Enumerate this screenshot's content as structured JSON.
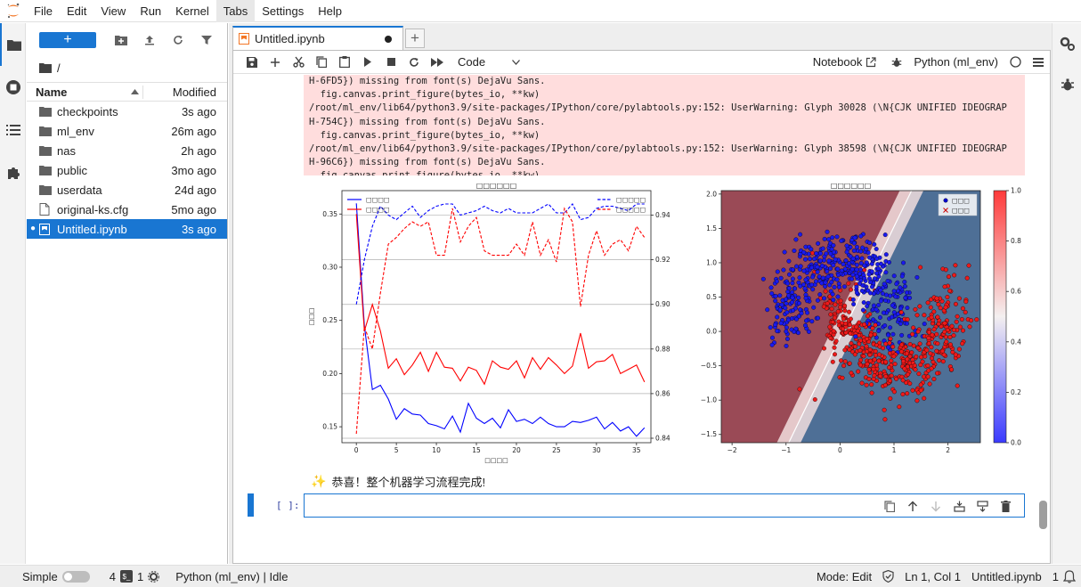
{
  "menubar": {
    "items": [
      "File",
      "Edit",
      "View",
      "Run",
      "Kernel",
      "Tabs",
      "Settings",
      "Help"
    ],
    "active_index": 5
  },
  "filebrowser": {
    "new_label": "+",
    "breadcrumb": "/",
    "header": {
      "name": "Name",
      "modified": "Modified"
    },
    "items": [
      {
        "name": "checkpoints",
        "modified": "3s ago",
        "type": "folder"
      },
      {
        "name": "ml_env",
        "modified": "26m ago",
        "type": "folder"
      },
      {
        "name": "nas",
        "modified": "2h ago",
        "type": "folder"
      },
      {
        "name": "public",
        "modified": "3mo ago",
        "type": "folder"
      },
      {
        "name": "userdata",
        "modified": "24d ago",
        "type": "folder"
      },
      {
        "name": "original-ks.cfg",
        "modified": "5mo ago",
        "type": "file"
      },
      {
        "name": "Untitled.ipynb",
        "modified": "3s ago",
        "type": "notebook",
        "selected": true,
        "running": true
      }
    ]
  },
  "tabs": {
    "active": {
      "label": "Untitled.ipynb",
      "dirty": true
    }
  },
  "notebook_toolbar": {
    "cell_type": "Code",
    "notebook_label": "Notebook",
    "kernel": "Python (ml_env)"
  },
  "stderr_lines": [
    "H-6FD5}) missing from font(s) DejaVu Sans.",
    "  fig.canvas.print_figure(bytes_io, **kw)",
    "/root/ml_env/lib64/python3.9/site-packages/IPython/core/pylabtools.py:152: UserWarning: Glyph 30028 (\\N{CJK UNIFIED IDEOGRAP",
    "H-754C}) missing from font(s) DejaVu Sans.",
    "  fig.canvas.print_figure(bytes_io, **kw)",
    "/root/ml_env/lib64/python3.9/site-packages/IPython/core/pylabtools.py:152: UserWarning: Glyph 38598 (\\N{CJK UNIFIED IDEOGRAP",
    "H-96C6}) missing from font(s) DejaVu Sans.",
    "  fig.canvas.print_figure(bytes_io, **kw)"
  ],
  "success_icon": "sparkles-icon",
  "success_message": "恭喜！整个机器学习流程完成!",
  "empty_cell_prompt": "[ ]:",
  "chart_data": [
    {
      "type": "line",
      "title": "□□□□□□",
      "xlabel": "□□□□",
      "ylabel": "□□□",
      "y2label": "□□□",
      "xlim": [
        -1.8,
        36.8
      ],
      "ylim": [
        0.135,
        0.372
      ],
      "y2lim": [
        0.838,
        0.951
      ],
      "xticks": [
        0,
        5,
        10,
        15,
        20,
        25,
        30,
        35
      ],
      "yticks": [
        0.15,
        0.2,
        0.25,
        0.3,
        0.35
      ],
      "y2ticks": [
        0.84,
        0.86,
        0.88,
        0.9,
        0.92,
        0.94
      ],
      "grid": true,
      "legend_left": "top-left",
      "legend_right": "top-right",
      "x": [
        0,
        1,
        2,
        3,
        4,
        5,
        6,
        7,
        8,
        9,
        10,
        11,
        12,
        13,
        14,
        15,
        16,
        17,
        18,
        19,
        20,
        21,
        22,
        23,
        24,
        25,
        26,
        27,
        28,
        29,
        30,
        31,
        32,
        33,
        34,
        35,
        36
      ],
      "series": [
        {
          "name": "□□□□",
          "axis": "left",
          "color": "#0000ff",
          "dash": false,
          "values": [
            0.36,
            0.245,
            0.185,
            0.189,
            0.176,
            0.157,
            0.167,
            0.162,
            0.161,
            0.153,
            0.151,
            0.148,
            0.16,
            0.145,
            0.172,
            0.158,
            0.153,
            0.158,
            0.149,
            0.166,
            0.155,
            0.157,
            0.153,
            0.159,
            0.153,
            0.15,
            0.15,
            0.155,
            0.154,
            0.156,
            0.159,
            0.148,
            0.154,
            0.146,
            0.15,
            0.141,
            0.149
          ]
        },
        {
          "name": "□□□□",
          "axis": "left",
          "color": "#ff0000",
          "dash": false,
          "values": [
            0.35,
            0.24,
            0.265,
            0.24,
            0.205,
            0.214,
            0.199,
            0.208,
            0.22,
            0.202,
            0.22,
            0.206,
            0.205,
            0.193,
            0.206,
            0.203,
            0.19,
            0.212,
            0.206,
            0.204,
            0.212,
            0.196,
            0.215,
            0.204,
            0.215,
            0.208,
            0.2,
            0.207,
            0.238,
            0.205,
            0.211,
            0.212,
            0.218,
            0.2,
            0.204,
            0.208,
            0.192
          ]
        },
        {
          "name": "□□□□□",
          "axis": "right",
          "color": "#0000ff",
          "dash": true,
          "values": [
            0.9,
            0.92,
            0.935,
            0.944,
            0.94,
            0.938,
            0.941,
            0.944,
            0.939,
            0.942,
            0.944,
            0.945,
            0.945,
            0.94,
            0.941,
            0.942,
            0.944,
            0.942,
            0.941,
            0.943,
            0.941,
            0.941,
            0.941,
            0.943,
            0.945,
            0.941,
            0.941,
            0.945,
            0.938,
            0.939,
            0.943,
            0.944,
            0.944,
            0.943,
            0.942,
            0.945,
            0.945
          ]
        },
        {
          "name": "□□□□□",
          "axis": "right",
          "color": "#ff0000",
          "dash": true,
          "values": [
            0.842,
            0.89,
            0.88,
            0.905,
            0.927,
            0.93,
            0.934,
            0.937,
            0.935,
            0.937,
            0.922,
            0.922,
            0.943,
            0.928,
            0.935,
            0.939,
            0.924,
            0.922,
            0.922,
            0.922,
            0.927,
            0.922,
            0.937,
            0.922,
            0.929,
            0.919,
            0.943,
            0.937,
            0.899,
            0.922,
            0.933,
            0.922,
            0.927,
            0.929,
            0.924,
            0.935,
            0.93
          ]
        }
      ]
    },
    {
      "type": "scatter",
      "title": "□□□□□□",
      "xlim": [
        -2.2,
        2.6
      ],
      "ylim": [
        -1.62,
        2.05
      ],
      "xticks": [
        -2,
        -1,
        0,
        1,
        2
      ],
      "yticks": [
        -1.5,
        -1.0,
        -0.5,
        0.0,
        0.5,
        1.0,
        1.5,
        2.0
      ],
      "legend": [
        {
          "name": "□□□",
          "marker": "circle",
          "color": "#0000cc"
        },
        {
          "name": "□□□",
          "marker": "x",
          "color": "#cc0000"
        }
      ],
      "legend_position": "top-right",
      "colorbar": {
        "min": 0.0,
        "max": 1.0,
        "ticks": [
          0.0,
          0.2,
          0.4,
          0.6,
          0.8,
          1.0
        ],
        "colormap": "bwr"
      },
      "point_count_per_class": 500,
      "dataset": "two moons"
    }
  ],
  "statusbar": {
    "mode_label": "Simple",
    "terminals_count": "4",
    "terminal_badge": "$_",
    "kernels_count": "1",
    "kernel_status": "Python (ml_env) | Idle",
    "mode": "Mode: Edit",
    "cursor": "Ln 1, Col 1",
    "filename": "Untitled.ipynb",
    "notifications": "1"
  }
}
